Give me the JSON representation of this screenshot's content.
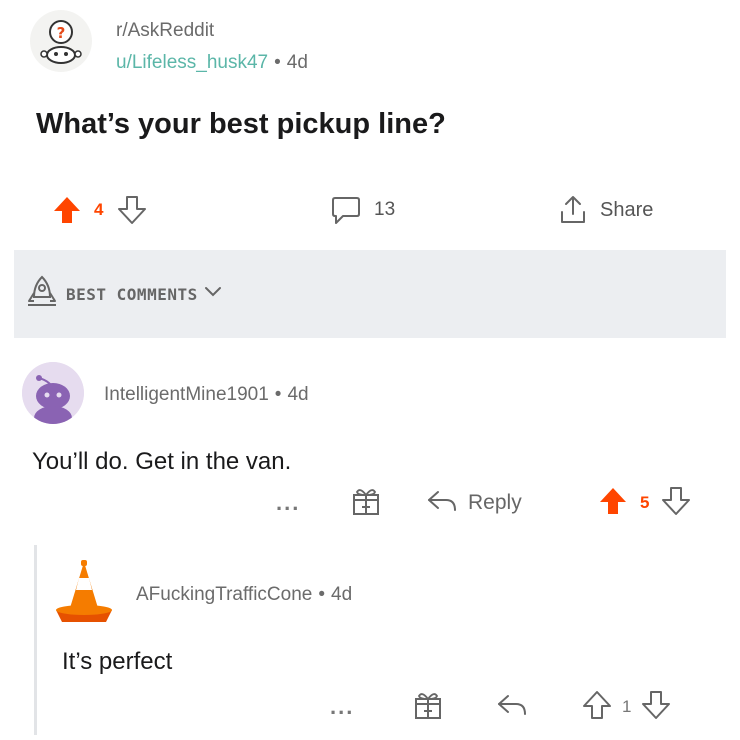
{
  "post": {
    "subreddit": "r/AskReddit",
    "author": "u/Lifeless_husk47",
    "separator": "•",
    "age": "4d",
    "title": "What’s your best pickup line?",
    "votes": "4",
    "comments": "13",
    "share_label": "Share"
  },
  "sort": {
    "label": "BEST COMMENTS"
  },
  "comments": [
    {
      "author": "IntelligentMine1901",
      "separator": "•",
      "age": "4d",
      "body": "You’ll do. Get in the van.",
      "more": "...",
      "reply_label": "Reply",
      "score": "5"
    },
    {
      "author": "AFuckingTrafficCone",
      "separator": "•",
      "age": "4d",
      "body": "It’s perfect",
      "more": "...",
      "score": "1"
    }
  ],
  "colors": {
    "upvote": "#ff4500",
    "username": "#5bb6a8",
    "sort_bar": "#eceef1"
  },
  "icons": {
    "subreddit": "askreddit-snoo-icon",
    "upvote": "arrow-up-icon",
    "downvote": "arrow-down-icon",
    "comment": "speech-bubble-icon",
    "share": "share-icon",
    "sort": "rocket-icon",
    "award": "gift-icon",
    "reply": "reply-arrow-icon"
  }
}
